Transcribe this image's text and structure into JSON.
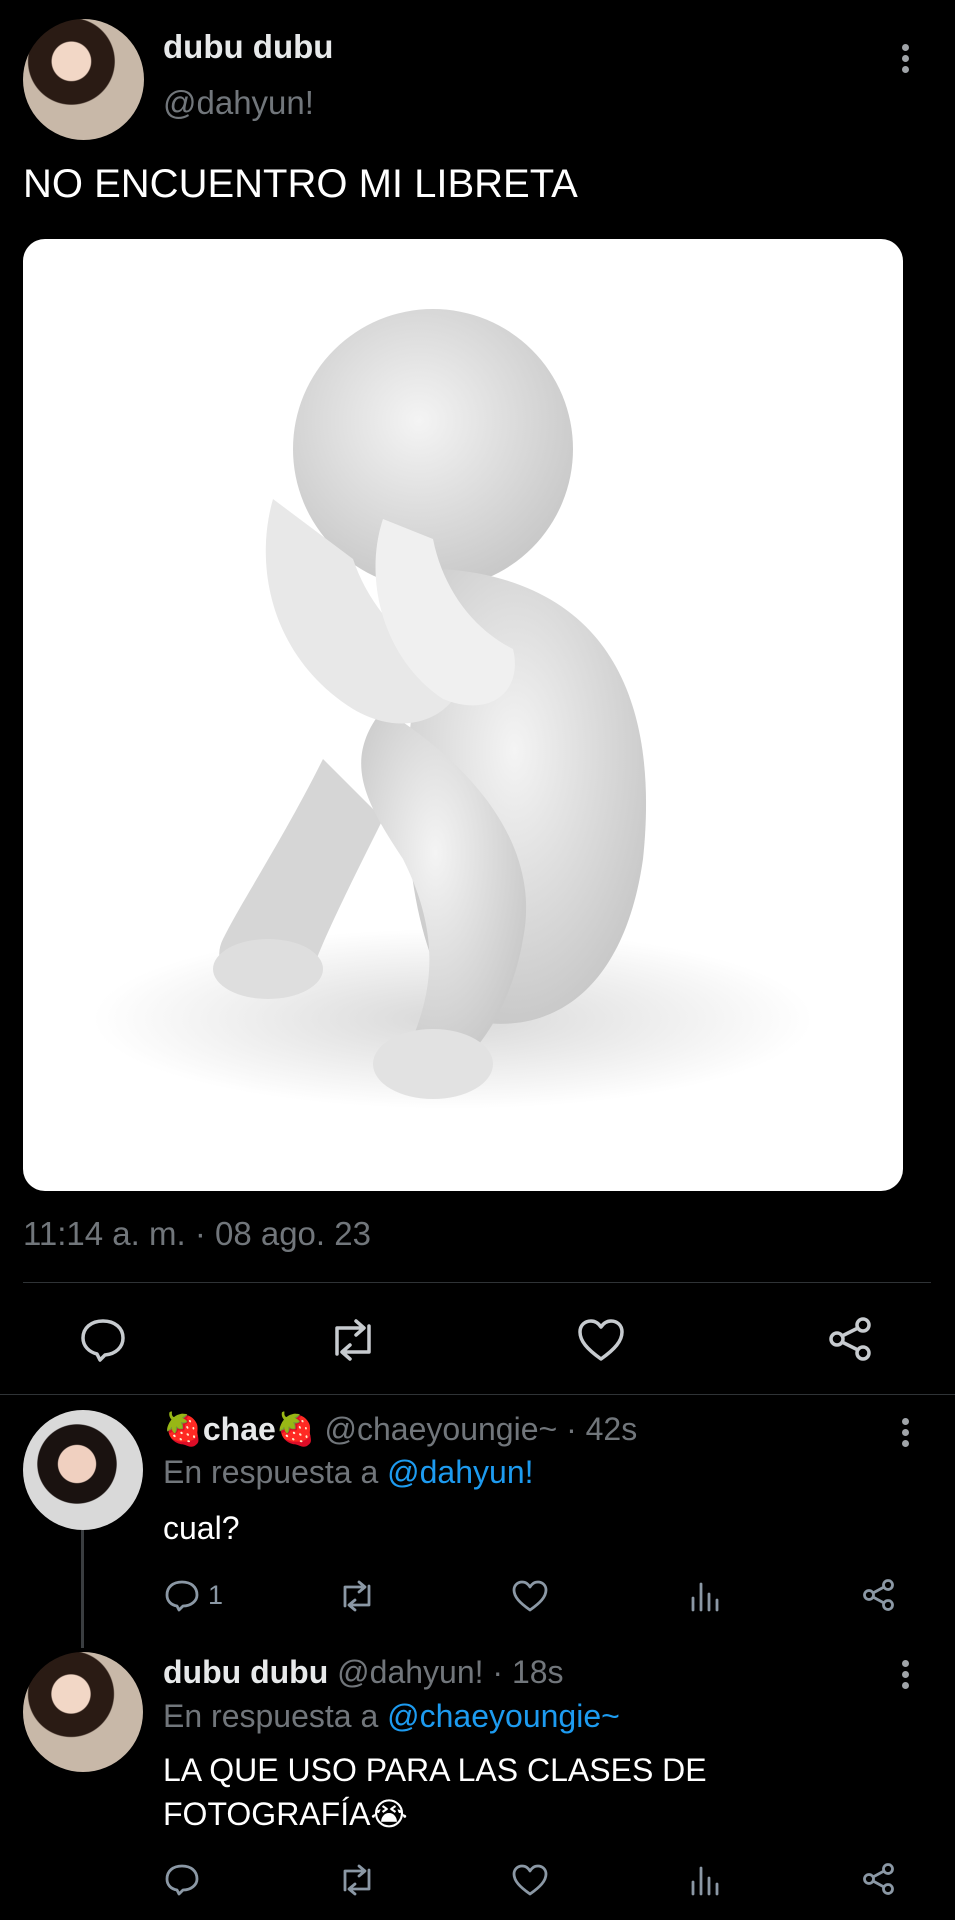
{
  "tweet": {
    "display_name": "dubu dubu",
    "handle": "@dahyun!",
    "text": "NO ENCUENTRO MI LIBRETA",
    "timestamp": "11:14 a. m. · 08 ago. 23"
  },
  "replies": [
    {
      "display_name": "🍓chae🍓",
      "handle": "@chaeyoungie~",
      "time": "· 42s",
      "reply_prefix": "En respuesta a",
      "reply_to": "@dahyun!",
      "text": "cual?",
      "reply_count": "1"
    },
    {
      "display_name": "dubu dubu",
      "handle": "@dahyun!",
      "time": "· 18s",
      "reply_prefix": "En respuesta a",
      "reply_to": "@chaeyoungie~",
      "text_line1": "LA QUE USO PARA LAS CLASES DE",
      "text_line2": "FOTOGRAFÍA😭"
    }
  ],
  "icons": {
    "more": "kebab-icon",
    "reply": "comment-icon",
    "retweet": "retweet-icon",
    "like": "heart-icon",
    "share": "share-icon",
    "views": "bar-chart-icon"
  },
  "colors": {
    "background": "#000000",
    "text": "#e7e9ea",
    "muted": "#71767b",
    "link": "#1d9bf0"
  }
}
